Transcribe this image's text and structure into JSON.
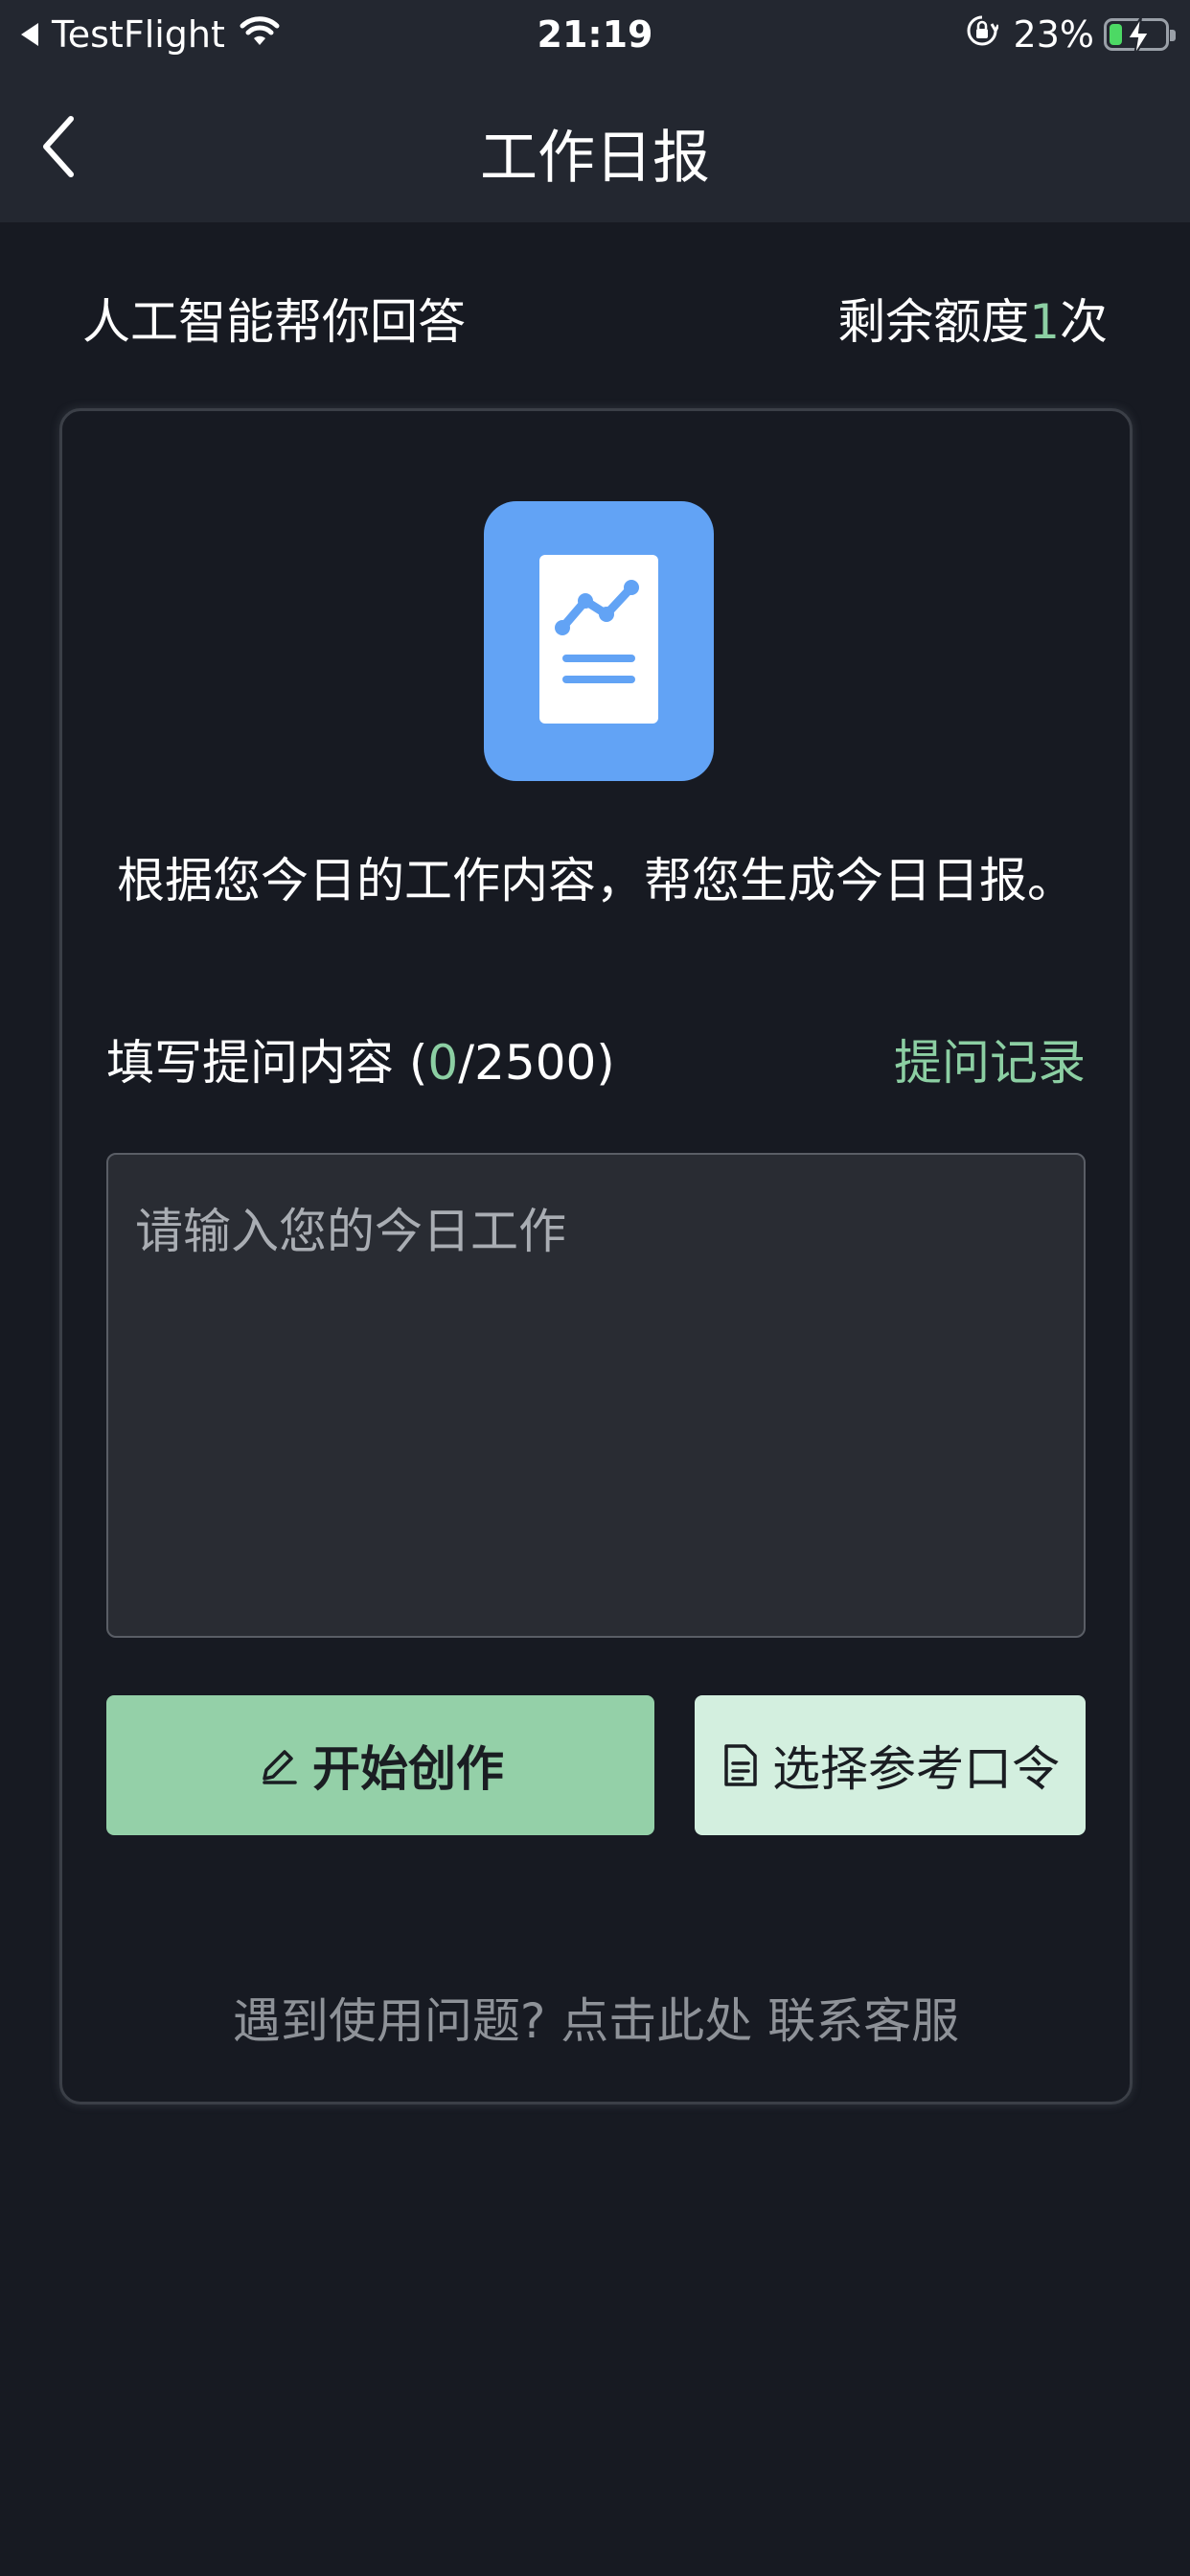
{
  "status_bar": {
    "carrier": "TestFlight",
    "time": "21:19",
    "battery_percent": "23%",
    "battery_level": 0.23
  },
  "nav": {
    "title": "工作日报"
  },
  "header": {
    "ai_label": "人工智能帮你回答",
    "quota_prefix": "剩余额度",
    "quota_count": "1",
    "quota_suffix": "次"
  },
  "card": {
    "intro": "根据您今日的工作内容，帮您生成今日日报。",
    "field_label_prefix": "填写提问内容 (",
    "field_count": "0",
    "field_label_suffix": "/2500)",
    "history_link": "提问记录",
    "input_placeholder": "请输入您的今日工作",
    "input_value": "",
    "start_button": "开始创作",
    "select_button": "选择参考口令",
    "help_text": "遇到使用问题? 点击此处",
    "help_link": "联系客服"
  },
  "icons": {
    "app_icon": "report-chart-icon",
    "start_icon": "pencil-icon",
    "select_icon": "document-icon"
  },
  "colors": {
    "background": "#171a22",
    "topbar": "#232730",
    "accent_green": "#8ccfa3",
    "start_button_bg": "#94d0a8",
    "select_button_bg": "#d3efdf",
    "app_icon_bg": "#62a3f5"
  }
}
